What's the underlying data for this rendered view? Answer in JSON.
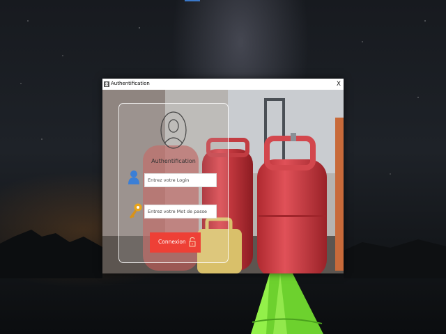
{
  "window": {
    "title": "Authentification",
    "close_label": "X"
  },
  "form": {
    "heading": "Authentification",
    "login_placeholder": "Entrez votre Login",
    "password_placeholder": "Entrez votre Mot de passe",
    "submit_label": "Connexion"
  },
  "icons": {
    "app": "app-icon",
    "avatar": "user-avatar-icon",
    "login": "user-icon",
    "password": "key-icon",
    "submit": "unlock-icon",
    "close": "close-icon"
  },
  "colors": {
    "button": "#ee4036",
    "cylinder": "#c8343c",
    "user_icon": "#3b7fd6",
    "key_icon": "#e8a41a",
    "tent": "#7fe23a"
  }
}
